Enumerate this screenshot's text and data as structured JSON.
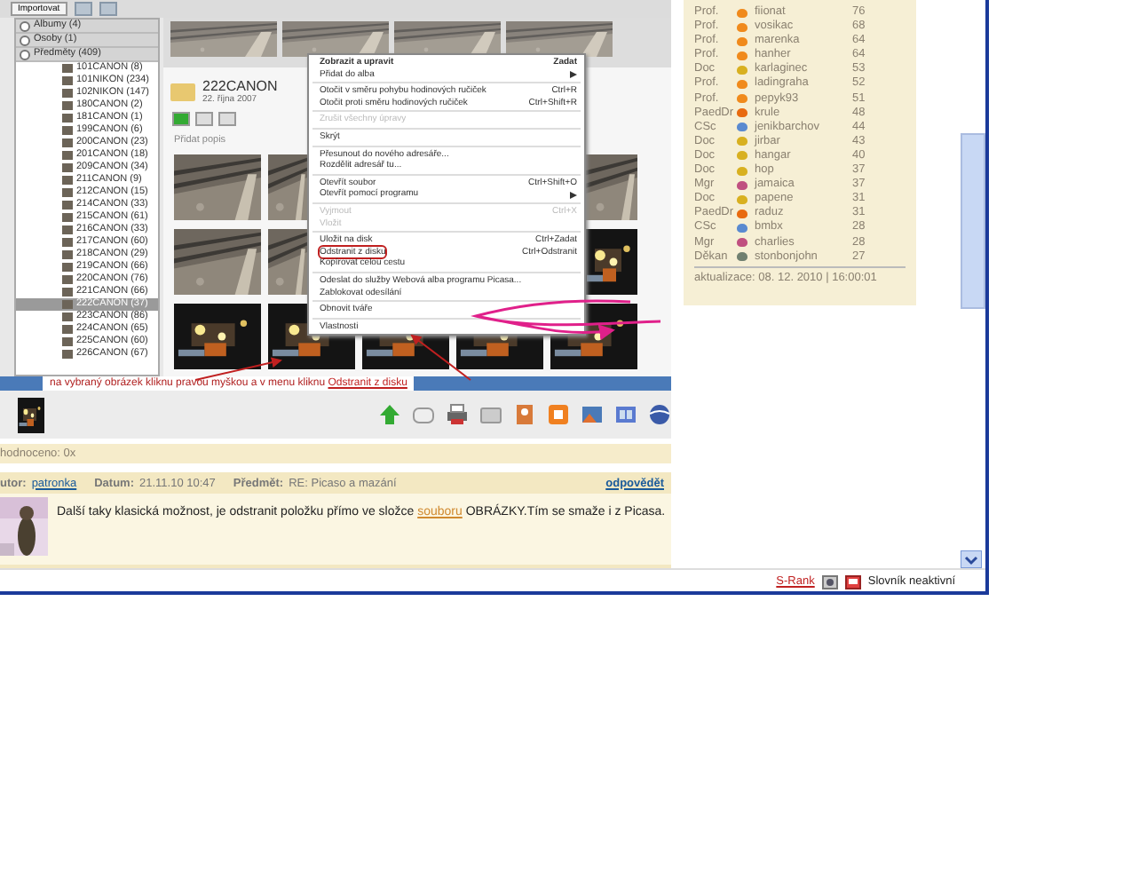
{
  "picasa": {
    "import_button": "Importovat",
    "library_sections": [
      {
        "label": "Albumy (4)"
      },
      {
        "label": "Osoby (1)"
      },
      {
        "label": "Předměty (409)"
      }
    ],
    "folders": [
      {
        "name": "101CANON (8)",
        "selected": false
      },
      {
        "name": "101NIKON (234)",
        "selected": false
      },
      {
        "name": "102NIKON (147)",
        "selected": false
      },
      {
        "name": "180CANON (2)",
        "selected": false
      },
      {
        "name": "181CANON (1)",
        "selected": false
      },
      {
        "name": "199CANON (6)",
        "selected": false
      },
      {
        "name": "200CANON (23)",
        "selected": false
      },
      {
        "name": "201CANON (18)",
        "selected": false
      },
      {
        "name": "209CANON (34)",
        "selected": false
      },
      {
        "name": "211CANON (9)",
        "selected": false
      },
      {
        "name": "212CANON (15)",
        "selected": false
      },
      {
        "name": "214CANON (33)",
        "selected": false
      },
      {
        "name": "215CANON (61)",
        "selected": false
      },
      {
        "name": "216CANON (33)",
        "selected": false
      },
      {
        "name": "217CANON (60)",
        "selected": false
      },
      {
        "name": "218CANON (29)",
        "selected": false
      },
      {
        "name": "219CANON (66)",
        "selected": false
      },
      {
        "name": "220CANON (76)",
        "selected": false
      },
      {
        "name": "221CANON (66)",
        "selected": false
      },
      {
        "name": "222CANON (37)",
        "selected": true
      },
      {
        "name": "223CANON (86)",
        "selected": false
      },
      {
        "name": "224CANON (65)",
        "selected": false
      },
      {
        "name": "225CANON (60)",
        "selected": false
      },
      {
        "name": "226CANON (67)",
        "selected": false
      }
    ],
    "folder_title": "222CANON",
    "folder_date": "22. října 2007",
    "description_placeholder": "Přidat popis",
    "context_menu": [
      {
        "kind": "item",
        "label": "Zobrazit a upravit",
        "shortcut": "Zadat",
        "default": true,
        "disabled": false,
        "submenu": false,
        "circled": false
      },
      {
        "kind": "item",
        "label": "Přidat do alba",
        "default": false,
        "disabled": false,
        "submenu": true,
        "circled": false
      },
      {
        "kind": "separator"
      },
      {
        "kind": "item",
        "label": "Otočit v směru pohybu hodinových ručiček",
        "shortcut": "Ctrl+R",
        "default": false,
        "disabled": false,
        "submenu": false,
        "circled": false
      },
      {
        "kind": "item",
        "label": "Otočit proti směru hodinových ručiček",
        "shortcut": "Ctrl+Shift+R",
        "default": false,
        "disabled": false,
        "submenu": false,
        "circled": false
      },
      {
        "kind": "separator"
      },
      {
        "kind": "item",
        "label": "Zrušit všechny úpravy",
        "default": false,
        "disabled": true,
        "submenu": false,
        "circled": false
      },
      {
        "kind": "separator"
      },
      {
        "kind": "item",
        "label": "Skrýt",
        "default": false,
        "disabled": false,
        "submenu": false,
        "circled": false
      },
      {
        "kind": "separator"
      },
      {
        "kind": "item",
        "label": "Přesunout do nového adresáře...",
        "default": false,
        "disabled": false,
        "submenu": false,
        "circled": false
      },
      {
        "kind": "item",
        "label": "Rozdělit adresář tu...",
        "default": false,
        "disabled": false,
        "submenu": false,
        "circled": false
      },
      {
        "kind": "separator"
      },
      {
        "kind": "item",
        "label": "Otevřít soubor",
        "shortcut": "Ctrl+Shift+O",
        "default": false,
        "disabled": false,
        "submenu": false,
        "circled": false
      },
      {
        "kind": "item",
        "label": "Otevřít pomocí programu",
        "default": false,
        "disabled": false,
        "submenu": true,
        "circled": false
      },
      {
        "kind": "separator"
      },
      {
        "kind": "item",
        "label": "Vyjmout",
        "shortcut": "Ctrl+X",
        "default": false,
        "disabled": true,
        "submenu": false,
        "circled": false
      },
      {
        "kind": "item",
        "label": "Vložit",
        "default": false,
        "disabled": true,
        "submenu": false,
        "circled": false
      },
      {
        "kind": "separator"
      },
      {
        "kind": "item",
        "label": "Uložit na disk",
        "shortcut": "Ctrl+Zadat",
        "default": false,
        "disabled": false,
        "submenu": false,
        "circled": false
      },
      {
        "kind": "item",
        "label": "Odstranit z disku",
        "shortcut": "Ctrl+Odstranit",
        "default": false,
        "disabled": false,
        "submenu": false,
        "circled": true
      },
      {
        "kind": "item",
        "label": "Kopírovat celou cestu",
        "default": false,
        "disabled": false,
        "submenu": false,
        "circled": false
      },
      {
        "kind": "separator"
      },
      {
        "kind": "item",
        "label": "Odeslat do služby Webová alba programu Picasa...",
        "default": false,
        "disabled": false,
        "submenu": false,
        "circled": false
      },
      {
        "kind": "item",
        "label": "Zablokovat odesílání",
        "default": false,
        "disabled": false,
        "submenu": false,
        "circled": false
      },
      {
        "kind": "separator"
      },
      {
        "kind": "item",
        "label": "Obnovit tváře",
        "default": false,
        "disabled": false,
        "submenu": false,
        "circled": false
      },
      {
        "kind": "separator"
      },
      {
        "kind": "item",
        "label": "Vlastnosti",
        "default": false,
        "disabled": false,
        "submenu": false,
        "circled": false
      }
    ],
    "annotation": "na vybraný obrázek kliknu pravou myškou a v menu kliknu ",
    "annotation_highlight": "Odstranit z disku"
  },
  "ranking": {
    "rows": [
      {
        "title": "Prof.",
        "color": "#f08a1c",
        "name": "fiionat",
        "score": "76"
      },
      {
        "title": "Prof.",
        "color": "#f08a1c",
        "name": "vosikac",
        "score": "68"
      },
      {
        "title": "Prof.",
        "color": "#f08a1c",
        "name": "marenka",
        "score": "64"
      },
      {
        "title": "Prof.",
        "color": "#f08a1c",
        "name": "hanher",
        "score": "64"
      },
      {
        "title": "Doc",
        "color": "#d8b020",
        "name": "karlaginec",
        "score": "53"
      },
      {
        "title": "Prof.",
        "color": "#f08a1c",
        "name": "ladingraha",
        "score": "52"
      },
      {
        "title": "Prof.",
        "color": "#f08a1c",
        "name": "pepyk93",
        "score": "51"
      },
      {
        "title": "PaedDr",
        "color": "#e86a10",
        "name": "krule",
        "score": "48"
      },
      {
        "title": "CSc",
        "color": "#5a8ad0",
        "name": "jenikbarchov",
        "score": "44"
      },
      {
        "title": "Doc",
        "color": "#d8b020",
        "name": "jirbar",
        "score": "43"
      },
      {
        "title": "Doc",
        "color": "#d8b020",
        "name": "hangar",
        "score": "40"
      },
      {
        "title": "Doc",
        "color": "#d8b020",
        "name": "hop",
        "score": "37"
      },
      {
        "title": "Mgr",
        "color": "#c05080",
        "name": "jamaica",
        "score": "37"
      },
      {
        "title": "Doc",
        "color": "#d8b020",
        "name": "papene",
        "score": "31"
      },
      {
        "title": "PaedDr",
        "color": "#e86a10",
        "name": "raduz",
        "score": "31"
      },
      {
        "title": "CSc",
        "color": "#5a8ad0",
        "name": "bmbx",
        "score": "28"
      },
      {
        "title": "Mgr",
        "color": "#c05080",
        "name": "charlies",
        "score": "28"
      },
      {
        "title": "Děkan",
        "color": "#708070",
        "name": "stonbonjohn",
        "score": "27"
      }
    ],
    "updated": "aktualizace: 08. 12. 2010 | 16:00:01"
  },
  "rating": "hodnoceno: 0x",
  "post": {
    "author_label": "utor:",
    "author": "patronka",
    "date_label": "Datum:",
    "date": "21.11.10 10:47",
    "subject_label": "Předmět:",
    "subject": "RE: Picaso a mazání",
    "reply": "odpovědět",
    "body": "Další taky klasická možnost, je odstranit položku přímo ve složce ",
    "link": "souboru",
    "body_end": " OBRÁZKY.Tím se smaže i z Picasa."
  },
  "status_bar": {
    "rank": "S-Rank",
    "dictionary": "Slovník neaktivní"
  }
}
